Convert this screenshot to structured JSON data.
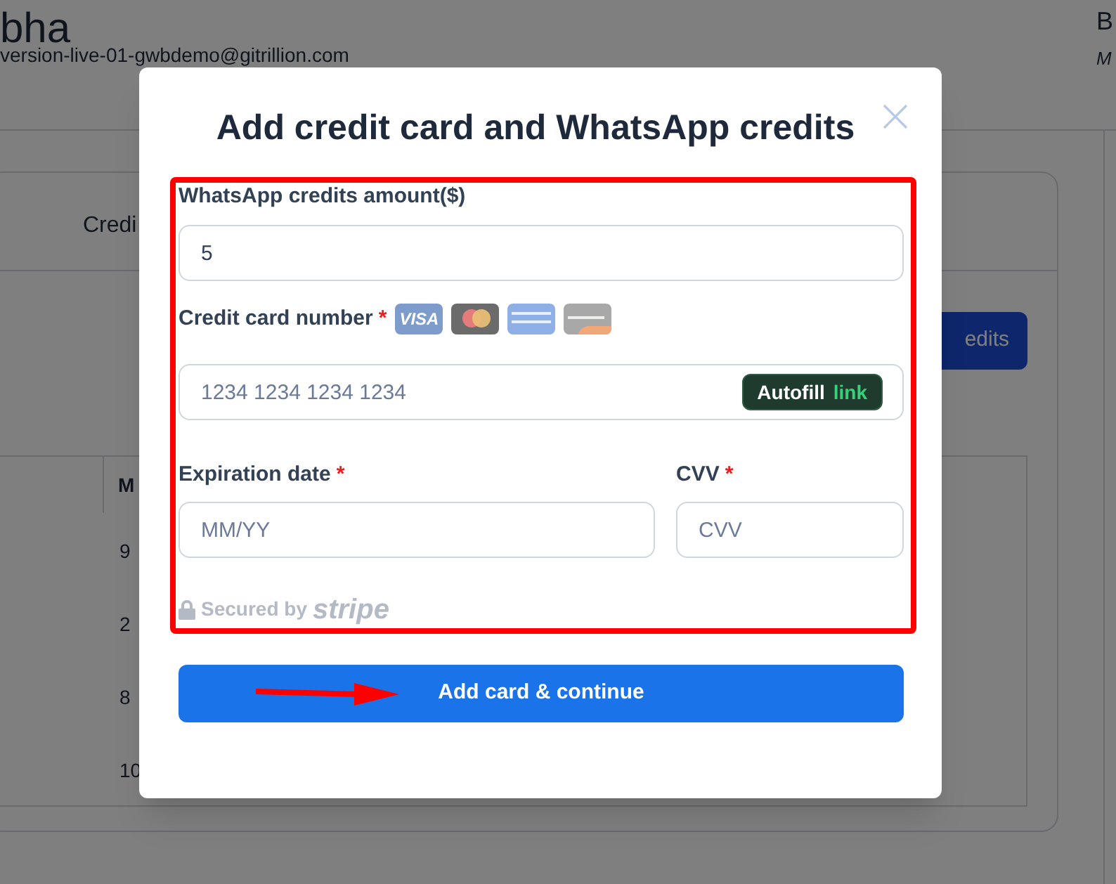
{
  "background": {
    "user_name": "bha",
    "user_email": "version-live-01-gwbdemo@gitrillion.com",
    "right_initial": "B",
    "right_subtitle": "M",
    "tab": "Credi",
    "button": "edits",
    "table": {
      "column": "M",
      "rows": [
        "9",
        "2",
        "8",
        "10"
      ]
    }
  },
  "modal": {
    "title": "Add credit card and WhatsApp credits",
    "amount": {
      "label": "WhatsApp credits amount($)",
      "value": "5"
    },
    "card_number": {
      "label": "Credit card number",
      "required_mark": "*",
      "placeholder": "1234 1234 1234 1234",
      "autofill": "Autofill",
      "autofill_brand": "link",
      "brands": [
        {
          "kind": "visa",
          "label": "VISA"
        },
        {
          "kind": "mastercard"
        },
        {
          "kind": "amex"
        },
        {
          "kind": "discover"
        }
      ]
    },
    "expiration": {
      "label": "Expiration date",
      "required_mark": "*",
      "placeholder": "MM/YY"
    },
    "cvv": {
      "label": "CVV",
      "required_mark": "*",
      "placeholder": "CVV"
    },
    "secured": {
      "text": "Secured by",
      "brand": "stripe"
    },
    "submit": "Add card & continue"
  }
}
